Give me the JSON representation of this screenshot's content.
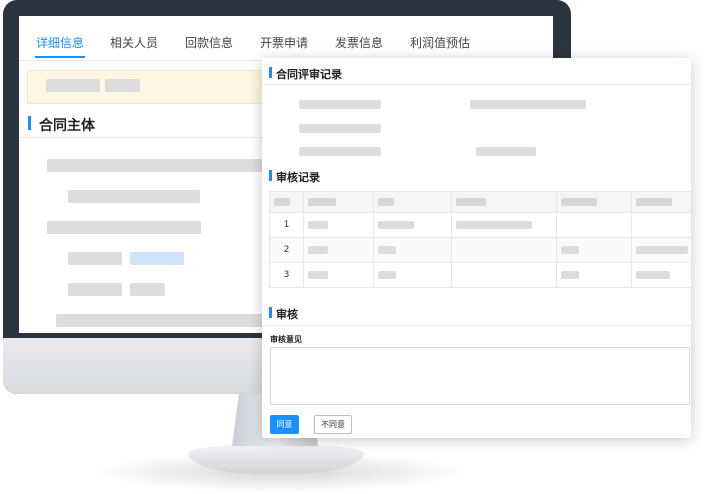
{
  "tabs": [
    {
      "label": "详细信息",
      "active": true
    },
    {
      "label": "相关人员"
    },
    {
      "label": "回款信息"
    },
    {
      "label": "开票申请"
    },
    {
      "label": "发票信息"
    },
    {
      "label": "利润值预估"
    }
  ],
  "background_section": {
    "title": "合同主体"
  },
  "modal": {
    "review_section_title": "合同评审记录",
    "audit_records_title": "审核记录",
    "audit_table": {
      "rows": [
        {
          "index": "1"
        },
        {
          "index": "2"
        },
        {
          "index": "3"
        }
      ]
    },
    "approval_title": "审核",
    "opinion_label": "审核意见",
    "opinion_value": "",
    "agree_label": "同意",
    "disagree_label": "不同意"
  },
  "colors": {
    "accent": "#1890ff",
    "monitor": "#2b3440",
    "placeholder_bar": "#dcdcdc",
    "notice_bg": "#fdf6e3"
  }
}
